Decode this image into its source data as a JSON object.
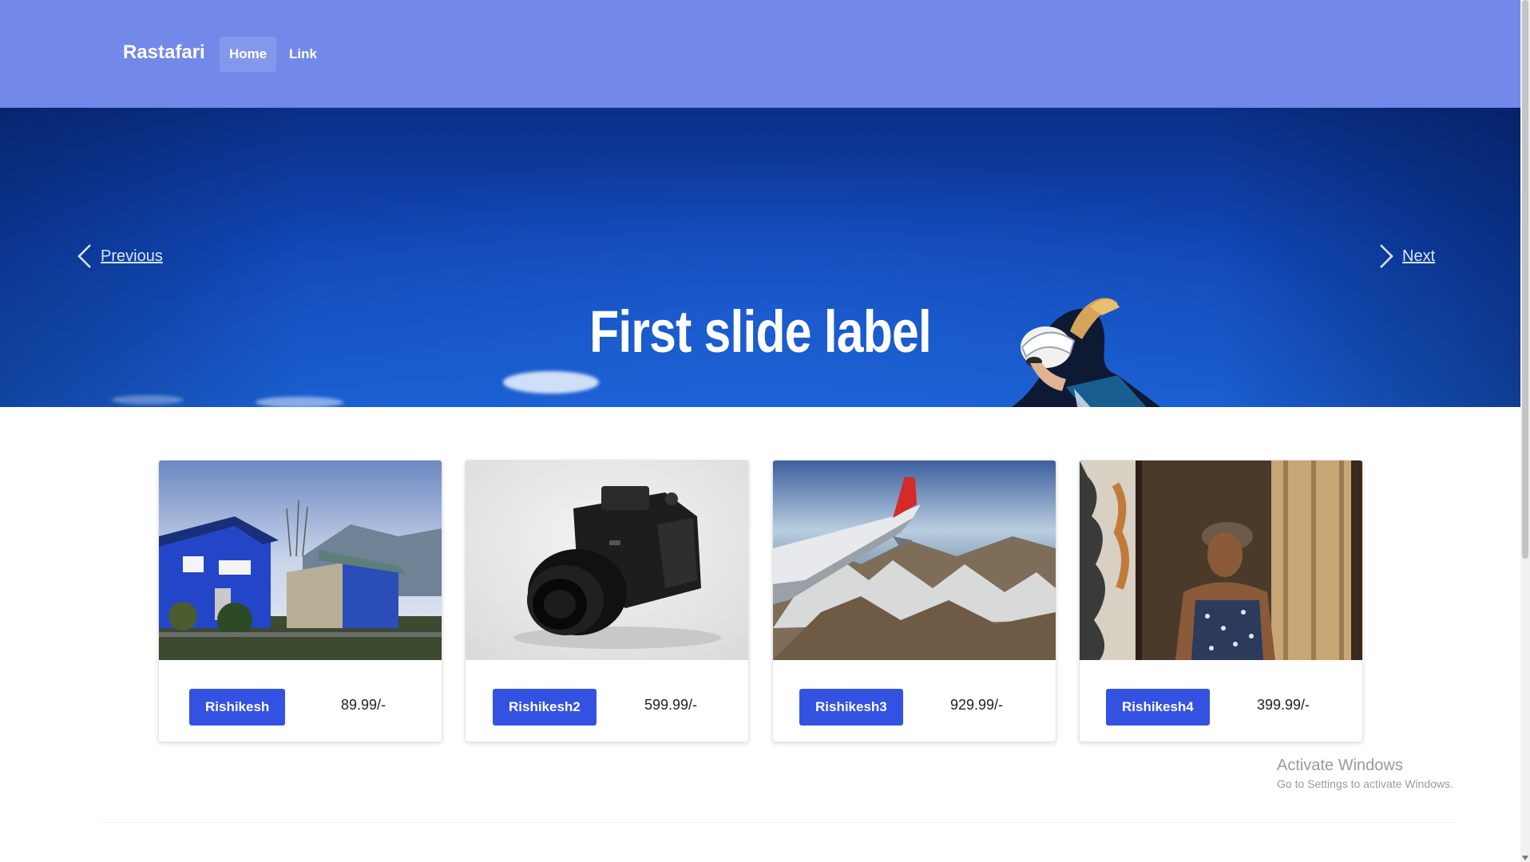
{
  "navbar": {
    "brand": "Rastafari",
    "links": [
      {
        "label": "Home",
        "active": true
      },
      {
        "label": "Link",
        "active": false
      }
    ],
    "background": "#7289ea"
  },
  "carousel": {
    "prev_label": "Previous",
    "next_label": "Next",
    "slide_label": "First slide label"
  },
  "cards": [
    {
      "button_label": "Rishikesh",
      "price": "89.99/-",
      "image": "house-photo"
    },
    {
      "button_label": "Rishikesh2",
      "price": "599.99/-",
      "image": "camera-photo"
    },
    {
      "button_label": "Rishikesh3",
      "price": "929.99/-",
      "image": "airplane-wing-photo"
    },
    {
      "button_label": "Rishikesh4",
      "price": "399.99/-",
      "image": "woman-portrait-photo"
    }
  ],
  "watermark": {
    "title": "Activate Windows",
    "subtitle": "Go to Settings to activate Windows."
  },
  "colors": {
    "accent": "#3452e1",
    "nav": "#7289ea"
  }
}
